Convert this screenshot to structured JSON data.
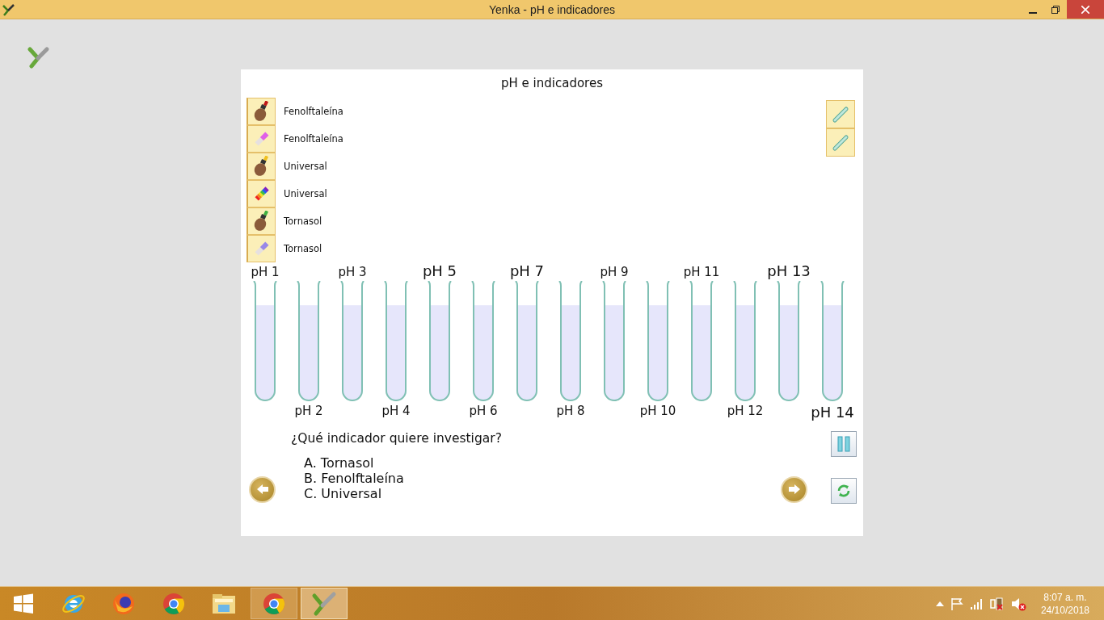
{
  "window": {
    "title": "Yenka - pH e indicadores"
  },
  "panel": {
    "title": "pH e indicadores",
    "indicators": [
      {
        "label": "Fenolftaleína",
        "kind": "bottle",
        "color": "#c01818"
      },
      {
        "label": "Fenolftaleína",
        "kind": "strip",
        "color": "#e060e8"
      },
      {
        "label": "Universal",
        "kind": "bottle",
        "color": "#f0c020"
      },
      {
        "label": "Universal",
        "kind": "rainbow"
      },
      {
        "label": "Tornasol",
        "kind": "bottle",
        "color": "#40b040"
      },
      {
        "label": "Tornasol",
        "kind": "strip",
        "color": "#9888e8"
      }
    ],
    "tubes": [
      {
        "label": "pH 1",
        "large": false,
        "level": 0.83
      },
      {
        "label": "pH 2",
        "large": false,
        "level": 0.83
      },
      {
        "label": "pH 3",
        "large": false,
        "level": 0.83
      },
      {
        "label": "pH 4",
        "large": false,
        "level": 0.83
      },
      {
        "label": "pH 5",
        "large": true,
        "level": 0.83
      },
      {
        "label": "pH 6",
        "large": false,
        "level": 0.83
      },
      {
        "label": "pH 7",
        "large": true,
        "level": 0.83
      },
      {
        "label": "pH 8",
        "large": false,
        "level": 0.83
      },
      {
        "label": "pH 9",
        "large": false,
        "level": 0.83
      },
      {
        "label": "pH 10",
        "large": false,
        "level": 0.83
      },
      {
        "label": "pH 11",
        "large": false,
        "level": 0.83
      },
      {
        "label": "pH 12",
        "large": false,
        "level": 0.83
      },
      {
        "label": "pH 13",
        "large": true,
        "level": 0.83
      },
      {
        "label": "pH 14",
        "large": true,
        "level": 0.83
      }
    ],
    "question": {
      "text": "¿Qué indicador quiere investigar?",
      "options": [
        "A. Tornasol",
        "B. Fenolftaleína",
        "C. Universal"
      ]
    }
  },
  "taskbar": {
    "apps": [
      {
        "kind": "ie",
        "open": false,
        "selected": false
      },
      {
        "kind": "firefox",
        "open": false,
        "selected": false
      },
      {
        "kind": "chrome",
        "open": false,
        "selected": false
      },
      {
        "kind": "explorer",
        "open": false,
        "selected": false
      },
      {
        "kind": "chrome",
        "open": true,
        "selected": false
      },
      {
        "kind": "yenka",
        "open": true,
        "selected": true
      }
    ],
    "clock": {
      "time": "8:07 a. m.",
      "date": "24/10/2018"
    }
  }
}
